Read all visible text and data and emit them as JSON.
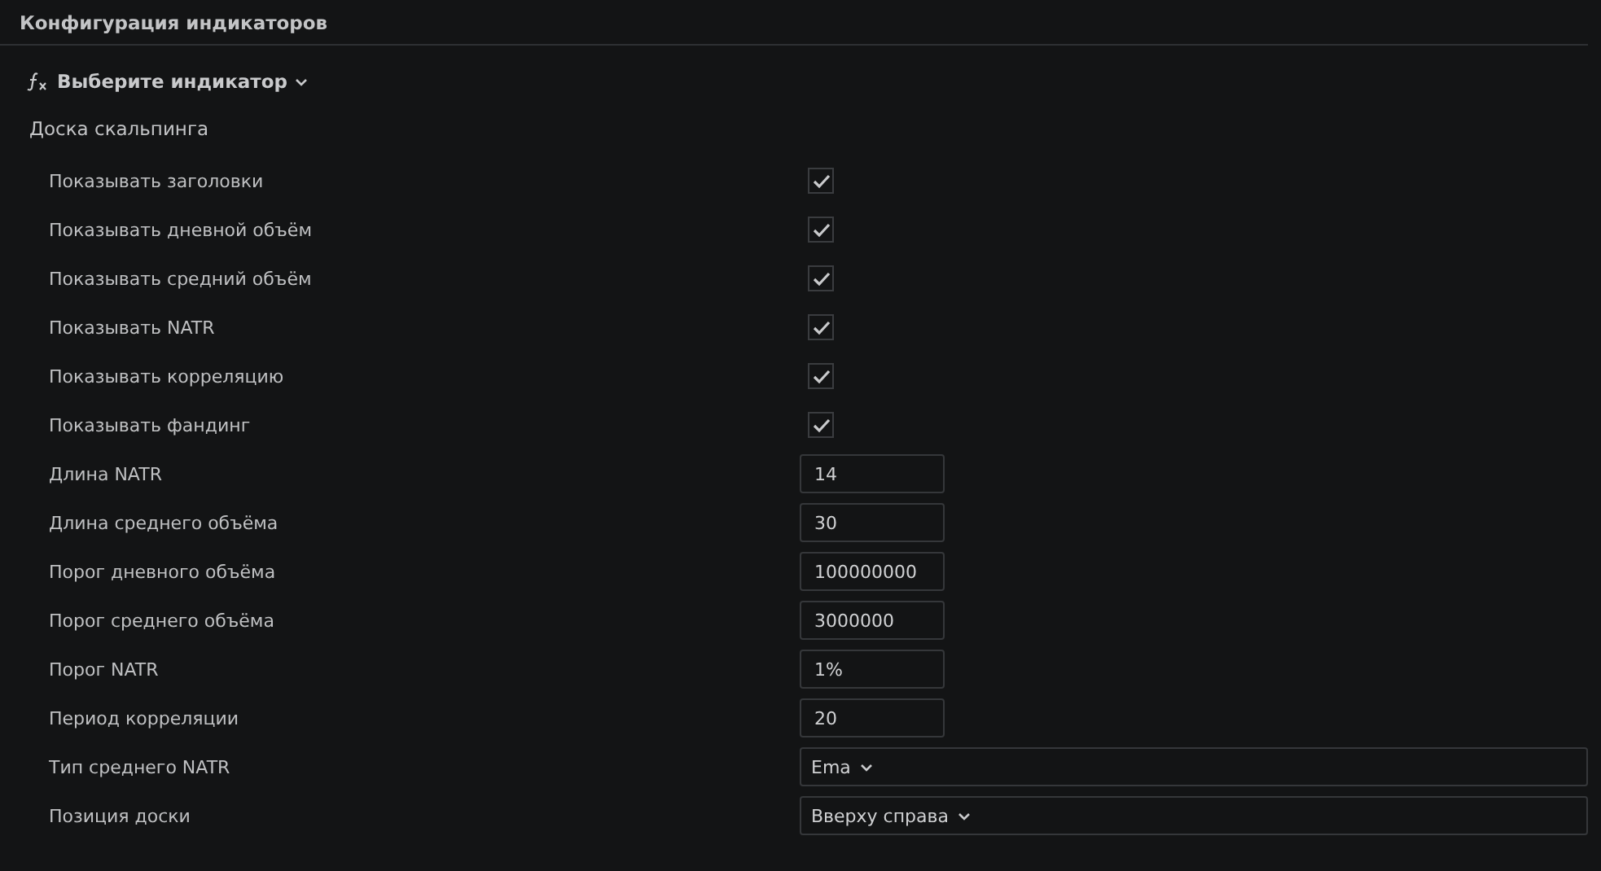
{
  "header": {
    "title": "Конфигурация индикаторов"
  },
  "indicator_picker": {
    "label": "Выберите индикатор"
  },
  "section": {
    "title": "Доска скальпинга"
  },
  "settings": [
    {
      "label": "Показывать заголовки",
      "kind": "checkbox",
      "checked": true
    },
    {
      "label": "Показывать дневной объём",
      "kind": "checkbox",
      "checked": true
    },
    {
      "label": "Показывать средний объём",
      "kind": "checkbox",
      "checked": true
    },
    {
      "label": "Показывать NATR",
      "kind": "checkbox",
      "checked": true
    },
    {
      "label": "Показывать корреляцию",
      "kind": "checkbox",
      "checked": true
    },
    {
      "label": "Показывать фандинг",
      "kind": "checkbox",
      "checked": true
    },
    {
      "label": "Длина NATR",
      "kind": "input",
      "value": "14"
    },
    {
      "label": "Длина среднего объёма",
      "kind": "input",
      "value": "30"
    },
    {
      "label": "Порог дневного объёма",
      "kind": "input",
      "value": "100000000"
    },
    {
      "label": "Порог среднего объёма",
      "kind": "input",
      "value": "3000000"
    },
    {
      "label": "Порог NATR",
      "kind": "input",
      "value": "1%"
    },
    {
      "label": "Период корреляции",
      "kind": "input",
      "value": "20"
    },
    {
      "label": "Тип среднего NATR",
      "kind": "select",
      "value": "Ema"
    },
    {
      "label": "Позиция доски",
      "kind": "select",
      "value": "Вверху справа"
    }
  ]
}
